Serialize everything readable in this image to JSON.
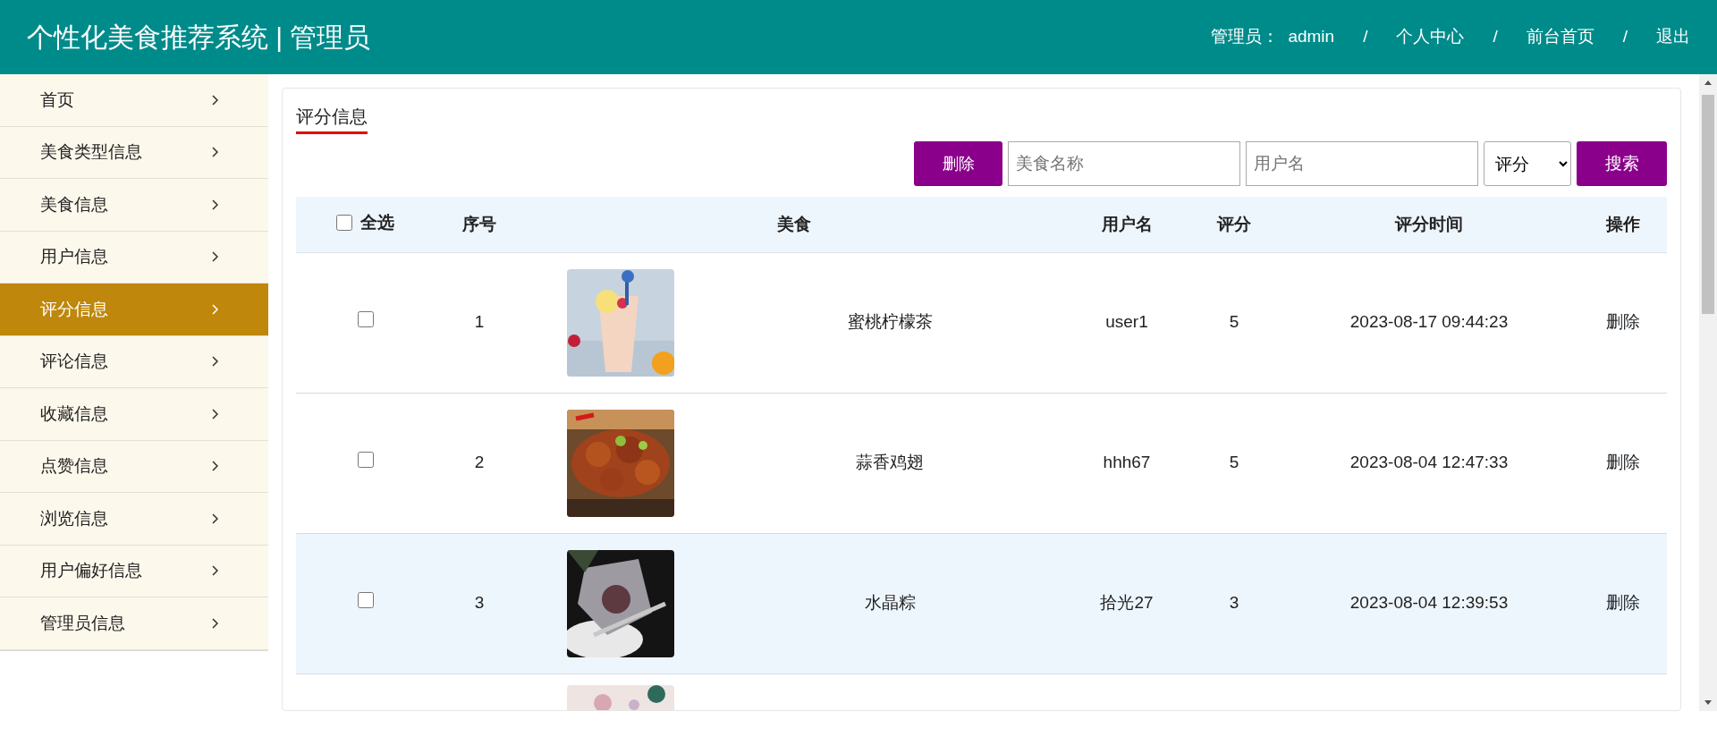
{
  "header": {
    "title": "个性化美食推荐系统 | 管理员",
    "user_label": "管理员：",
    "user_name": "admin",
    "links": [
      {
        "separator": "/",
        "text": "个人中心"
      },
      {
        "separator": "/",
        "text": "前台首页"
      },
      {
        "separator": "/",
        "text": "退出"
      }
    ]
  },
  "sidebar": {
    "items": [
      {
        "label": "首页",
        "selected": false
      },
      {
        "label": "美食类型信息",
        "selected": false
      },
      {
        "label": "美食信息",
        "selected": false
      },
      {
        "label": "用户信息",
        "selected": false
      },
      {
        "label": "评分信息",
        "selected": true
      },
      {
        "label": "评论信息",
        "selected": false
      },
      {
        "label": "收藏信息",
        "selected": false
      },
      {
        "label": "点赞信息",
        "selected": false
      },
      {
        "label": "浏览信息",
        "selected": false
      },
      {
        "label": "用户偏好信息",
        "selected": false
      },
      {
        "label": "管理员信息",
        "selected": false
      }
    ]
  },
  "panel": {
    "title": "评分信息",
    "delete_button": "删除",
    "search": [
      {
        "placeholder": "美食名称"
      },
      {
        "placeholder": "用户名"
      }
    ],
    "score_select": "评分",
    "search_button": "搜索"
  },
  "table": {
    "select_all": {
      "label": "全选",
      "checked": false
    },
    "columns": [
      "序号",
      "美食",
      "用户名",
      "评分",
      "评分时间",
      "操作"
    ],
    "rows": [
      {
        "kind": "record",
        "hovered": false,
        "checked": false,
        "index": "1",
        "food": "蜜桃柠檬茶",
        "user": "user1",
        "score": "5",
        "time": "2023-08-17 09:44:23",
        "action": "删除"
      },
      {
        "kind": "record",
        "hovered": false,
        "checked": false,
        "index": "2",
        "food": "蒜香鸡翅",
        "user": "hhh67",
        "score": "5",
        "time": "2023-08-04 12:47:33",
        "action": "删除"
      },
      {
        "kind": "record",
        "hovered": true,
        "checked": false,
        "index": "3",
        "food": "水晶粽",
        "user": "拾光27",
        "score": "3",
        "time": "2023-08-04 12:39:53",
        "action": "删除"
      },
      {
        "kind": "cut"
      }
    ]
  }
}
